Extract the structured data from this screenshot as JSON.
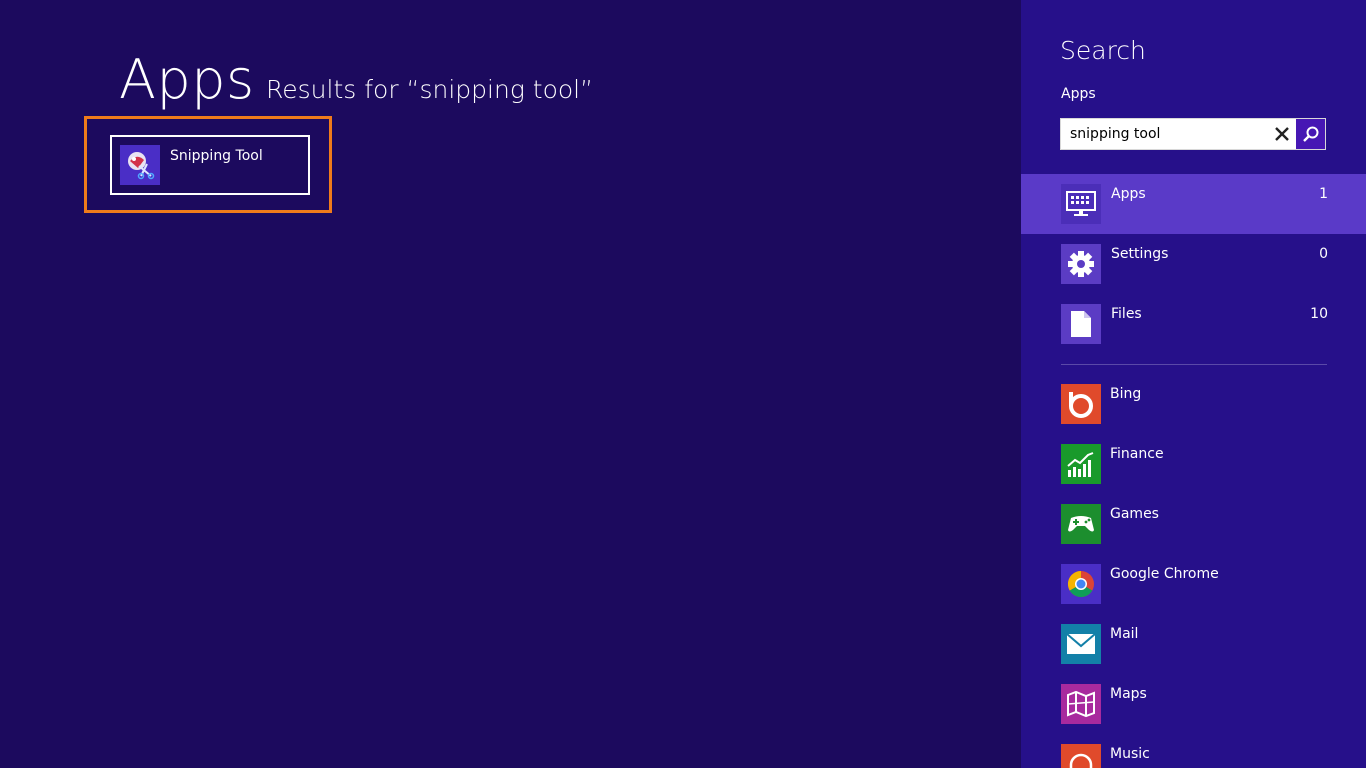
{
  "main": {
    "title": "Apps",
    "results_for": "Results for “snipping tool”",
    "results": [
      {
        "label": "Snipping Tool",
        "icon": "snipping-tool-icon"
      }
    ]
  },
  "pane": {
    "title": "Search",
    "scope_label": "Apps",
    "search": {
      "value": "snipping tool",
      "placeholder": ""
    },
    "scopes": [
      {
        "label": "Apps",
        "count": "1",
        "icon": "apps-monitor-icon",
        "selected": true
      },
      {
        "label": "Settings",
        "count": "0",
        "icon": "gear-icon",
        "selected": false
      },
      {
        "label": "Files",
        "count": "10",
        "icon": "file-icon",
        "selected": false
      }
    ],
    "apps": [
      {
        "label": "Bing",
        "icon": "bing-icon",
        "color": "#e04a2b"
      },
      {
        "label": "Finance",
        "icon": "finance-chart-icon",
        "color": "#199a2b"
      },
      {
        "label": "Games",
        "icon": "gamepad-icon",
        "color": "#1c8e2e"
      },
      {
        "label": "Google Chrome",
        "icon": "chrome-icon",
        "color": "#4a2ec6"
      },
      {
        "label": "Mail",
        "icon": "mail-icon",
        "color": "#1380a8"
      },
      {
        "label": "Maps",
        "icon": "maps-icon",
        "color": "#a82a9e"
      },
      {
        "label": "Music",
        "icon": "music-icon",
        "color": "#e04a2b"
      }
    ]
  },
  "colors": {
    "background": "#1c0a5e",
    "pane": "#26108a",
    "selected_row": "#5a3ac8",
    "highlight": "#f07b1b"
  }
}
